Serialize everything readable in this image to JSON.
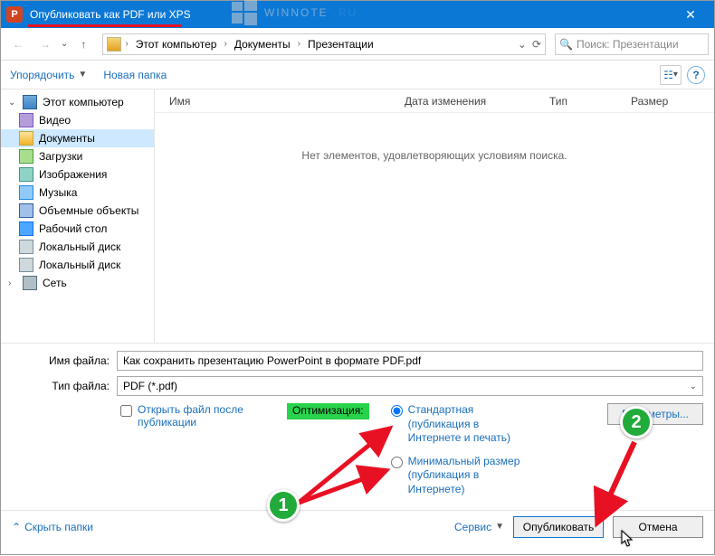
{
  "titlebar": {
    "title": "Опубликовать как PDF или XPS",
    "app_letter": "P",
    "close": "✕"
  },
  "nav": {
    "back": "←",
    "fwd": "→",
    "up": "↑",
    "crumbs": [
      "Этот компьютер",
      "Документы",
      "Презентации"
    ],
    "search_placeholder": "Поиск: Презентации"
  },
  "toolbar": {
    "organize": "Упорядочить",
    "new_folder": "Новая папка"
  },
  "tree": {
    "items": [
      {
        "label": "Этот компьютер",
        "icon": "ic-pc",
        "root": true,
        "exp": "⌄"
      },
      {
        "label": "Видео",
        "icon": "ic-video"
      },
      {
        "label": "Документы",
        "icon": "ic-folder",
        "selected": true
      },
      {
        "label": "Загрузки",
        "icon": "ic-down"
      },
      {
        "label": "Изображения",
        "icon": "ic-image"
      },
      {
        "label": "Музыка",
        "icon": "ic-music"
      },
      {
        "label": "Объемные объекты",
        "icon": "ic-volume"
      },
      {
        "label": "Рабочий стол",
        "icon": "ic-desktop"
      },
      {
        "label": "Локальный диск",
        "icon": "ic-drive"
      },
      {
        "label": "Локальный диск",
        "icon": "ic-drive"
      },
      {
        "label": "Сеть",
        "icon": "ic-net",
        "root": true,
        "exp": "›"
      }
    ]
  },
  "columns": {
    "name": "Имя",
    "date": "Дата изменения",
    "type": "Тип",
    "size": "Размер"
  },
  "empty": "Нет элементов, удовлетворяющих условиям поиска.",
  "form": {
    "filename_label": "Имя файла:",
    "filename_value": "Как сохранить презентацию PowerPoint в формате PDF.pdf",
    "filetype_label": "Тип файла:",
    "filetype_value": "PDF (*.pdf)",
    "open_after": "Открыть файл после публикации",
    "optimization": "Оптимизация:",
    "radio1": "Стандартная (публикация в Интернете и печать)",
    "radio2": "Минимальный размер (публикация в Интернете)",
    "params": "Параметры..."
  },
  "footer": {
    "hide_folders": "Скрыть папки",
    "service": "Сервис",
    "publish": "Опубликовать",
    "cancel": "Отмена"
  },
  "watermark": {
    "text": "WINNOTE",
    "suffix": ".RU"
  },
  "markers": {
    "m1": "1",
    "m2": "2"
  }
}
